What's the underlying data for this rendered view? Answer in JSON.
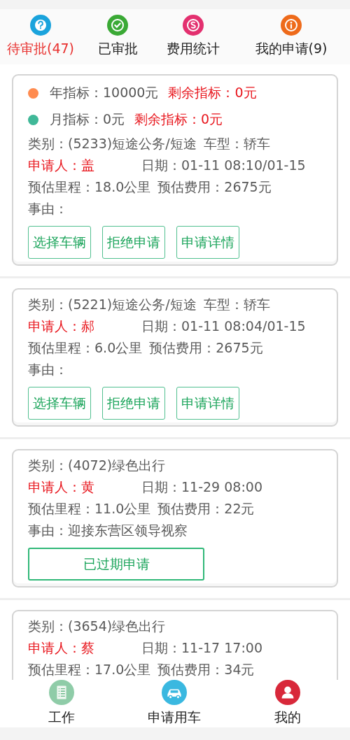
{
  "tabs": [
    {
      "label": "待审批(47)",
      "selected": true,
      "kind": "question"
    },
    {
      "label": "已审批",
      "selected": false,
      "kind": "check"
    },
    {
      "label": "费用统计",
      "selected": false,
      "kind": "dollar"
    },
    {
      "label": "我的申请(9)",
      "selected": false,
      "kind": "info"
    }
  ],
  "requests": [
    {
      "quotas": [
        {
          "label": "年指标：10000元",
          "remaining": "剩余指标：0元",
          "color": "#ff8c50"
        },
        {
          "label": "月指标：0元",
          "remaining": "剩余指标：0元",
          "color": "#40b898"
        }
      ],
      "category": "类别：(5233)短途公务/短途",
      "vehicle_type": "车型：轿车",
      "applicant": "申请人：盖",
      "date": "日期：01-11 08:10/01-15",
      "mileage": "预估里程：18.0公里",
      "cost": "预估费用：2675元",
      "reason": "事由：",
      "actions": [
        {
          "label": "选择车辆",
          "kind": "normal"
        },
        {
          "label": "拒绝申请",
          "kind": "normal"
        },
        {
          "label": "申请详情",
          "kind": "normal"
        }
      ]
    },
    {
      "category": "类别：(5221)短途公务/短途",
      "vehicle_type": "车型：轿车",
      "applicant": "申请人：郝",
      "date": "日期：01-11 08:04/01-15",
      "mileage": "预估里程：6.0公里",
      "cost": "预估费用：2675元",
      "reason": "事由：",
      "actions": [
        {
          "label": "选择车辆",
          "kind": "normal"
        },
        {
          "label": "拒绝申请",
          "kind": "normal"
        },
        {
          "label": "申请详情",
          "kind": "normal"
        }
      ]
    },
    {
      "category": "类别：(4072)绿色出行",
      "applicant": "申请人：黄",
      "date": "日期：11-29 08:00",
      "mileage": "预估里程：11.0公里",
      "cost": "预估费用：22元",
      "reason": "事由：迎接东营区领导视察",
      "actions": [
        {
          "label": "已过期申请",
          "kind": "wide"
        }
      ]
    },
    {
      "category": "类别：(3654)绿色出行",
      "applicant": "申请人：蔡",
      "date": "日期：11-17 17:00",
      "mileage": "预估里程：17.0公里",
      "cost": "预估费用：34元"
    }
  ],
  "bottom_nav": [
    {
      "label": "工作",
      "kind": "list"
    },
    {
      "label": "申请用车",
      "kind": "car"
    },
    {
      "label": "我的",
      "kind": "person"
    }
  ]
}
